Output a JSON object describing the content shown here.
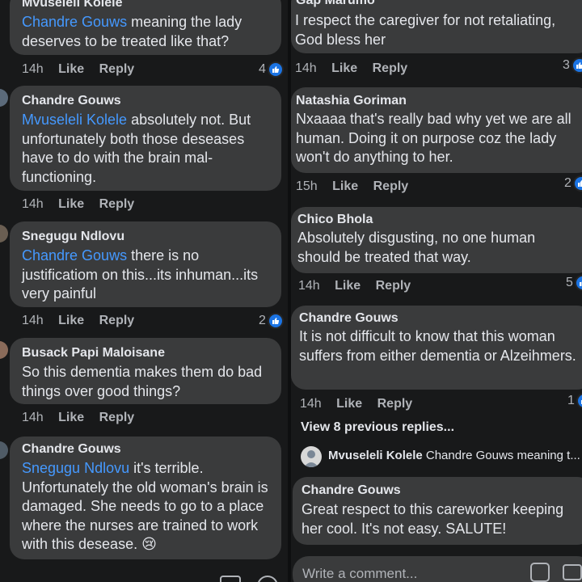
{
  "left": {
    "comments": [
      {
        "author": "Mvuseleli Kolele",
        "mention": "Chandre Gouws",
        "text": " meaning the lady deserves to be treated like that?",
        "time": "14h",
        "like": "Like",
        "reply": "Reply",
        "reactions": "4"
      },
      {
        "author": "Chandre Gouws",
        "mention": "Mvuseleli Kolele",
        "text": " absolutely not. But unfortunately both those deseases have to do with the brain mal-functioning.",
        "time": "14h",
        "like": "Like",
        "reply": "Reply",
        "reactions": ""
      },
      {
        "author": "Snegugu Ndlovu",
        "mention": "Chandre Gouws",
        "text": " there is no justificatiom on this...its inhuman...its very painful",
        "time": "14h",
        "like": "Like",
        "reply": "Reply",
        "reactions": "2"
      },
      {
        "author": "Busack Papi Maloisane",
        "mention": "",
        "text": "So this dementia makes them do bad things over good things?",
        "time": "14h",
        "like": "Like",
        "reply": "Reply",
        "reactions": ""
      },
      {
        "author": "Chandre Gouws",
        "mention": "Snegugu Ndlovu",
        "text": " it's terrible. Unfortunately the old woman's brain is damaged. She needs to go to a place where the nurses are trained to work with this desease. 😢",
        "time": "",
        "like": "",
        "reply": "",
        "reactions": ""
      }
    ]
  },
  "right": {
    "comments": [
      {
        "author": "Gap Marumo",
        "text": "I respect the caregiver for not retaliating, God bless her",
        "time": "14h",
        "like": "Like",
        "reply": "Reply",
        "reactions": "3"
      },
      {
        "author": "Natashia Goriman",
        "text": "Nxaaaa that's really bad why yet we are all human. Doing it on purpose coz the lady won't do anything to her.",
        "time": "15h",
        "like": "Like",
        "reply": "Reply",
        "reactions": "2"
      },
      {
        "author": "Chico Bhola",
        "text": "Absolutely disgusting, no one human should be treated that way.",
        "time": "14h",
        "like": "Like",
        "reply": "Reply",
        "reactions": "5"
      },
      {
        "author": "Chandre Gouws",
        "text": "It is not difficult to know that this woman suffers from either dementia or Alzeihmers.",
        "time": "14h",
        "like": "Like",
        "reply": "Reply",
        "reactions": "1"
      },
      {
        "author": "Chandre Gouws",
        "text": "Great respect to this careworker keeping her cool. It's not easy.  SALUTE!",
        "time": "",
        "like": "",
        "reply": "",
        "reactions": ""
      }
    ],
    "view_previous": "View 8 previous replies...",
    "reply_summary": {
      "author": "Mvuseleli Kolele",
      "text": " Chandre Gouws meaning t..."
    },
    "composer_placeholder": "Write a comment..."
  },
  "colors": {
    "background": "#18191a",
    "bubble": "#3a3b3c",
    "mention": "#4599ff",
    "meta": "#b0b3b8",
    "like_blue": "#1b74e4"
  }
}
